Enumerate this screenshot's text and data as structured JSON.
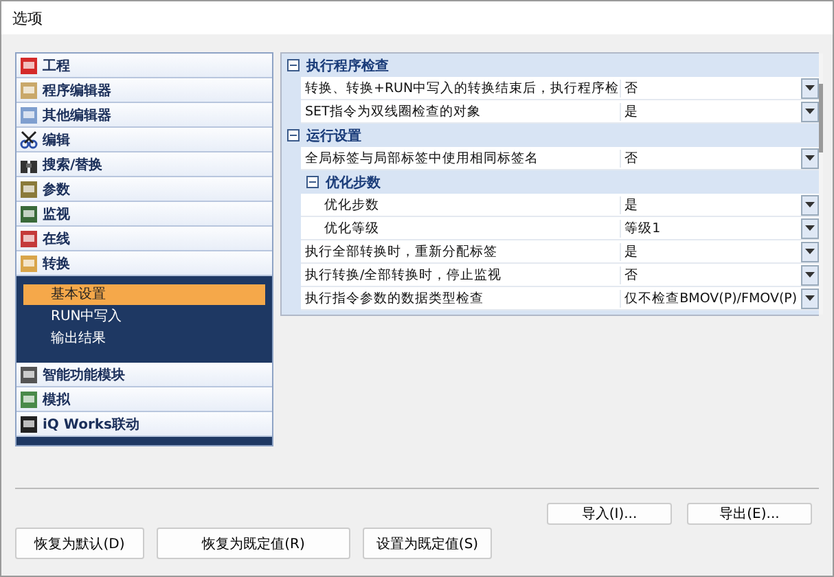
{
  "window": {
    "title": "选项"
  },
  "nav": [
    {
      "label": "工程"
    },
    {
      "label": "程序编辑器"
    },
    {
      "label": "其他编辑器"
    },
    {
      "label": "编辑"
    },
    {
      "label": "搜索/替换"
    },
    {
      "label": "参数"
    },
    {
      "label": "监视"
    },
    {
      "label": "在线"
    },
    {
      "label": "转换",
      "children": [
        {
          "label": "基本设置",
          "selected": true
        },
        {
          "label": "RUN中写入",
          "selected": false
        },
        {
          "label": "输出结果",
          "selected": false
        }
      ]
    },
    {
      "label": "智能功能模块"
    },
    {
      "label": "模拟"
    },
    {
      "label": "iQ Works联动"
    }
  ],
  "grid": [
    {
      "kind": "section",
      "label": "执行程序检查",
      "expanded": true,
      "children": [
        {
          "kind": "row",
          "label": "转换、转换+RUN中写入的转换结束后，执行程序检",
          "value": "否"
        },
        {
          "kind": "row",
          "label": "SET指令为双线圈检查的对象",
          "value": "是"
        }
      ]
    },
    {
      "kind": "section",
      "label": "运行设置",
      "expanded": true,
      "children": [
        {
          "kind": "row",
          "label": "全局标签与局部标签中使用相同标签名",
          "value": "否"
        },
        {
          "kind": "section",
          "label": "优化步数",
          "expanded": true,
          "children": [
            {
              "kind": "row",
              "label": "优化步数",
              "value": "是"
            },
            {
              "kind": "row",
              "label": "优化等级",
              "value": "等级1"
            }
          ]
        },
        {
          "kind": "row",
          "label": "执行全部转换时，重新分配标签",
          "value": "是"
        },
        {
          "kind": "row",
          "label": "执行转换/全部转换时，停止监视",
          "value": "否"
        },
        {
          "kind": "row",
          "label": "执行指令参数的数据类型检查",
          "value": "仅不检查BMOV(P)/FMOV(P)"
        }
      ]
    }
  ],
  "buttons_top": [
    "导入(I)...",
    "导出(E)..."
  ],
  "buttons_bottom": [
    "恢复为默认(D)",
    "恢复为既定值(R)",
    "设置为既定值(S)"
  ]
}
